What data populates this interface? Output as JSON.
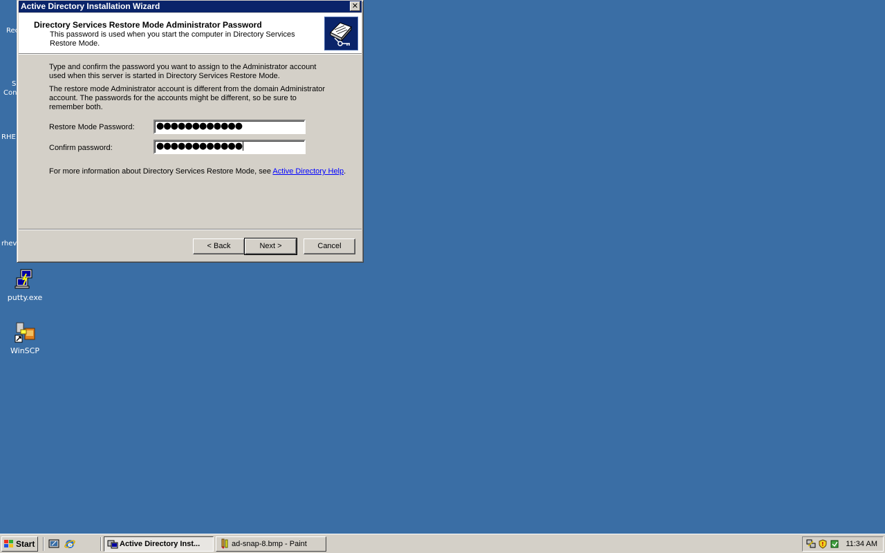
{
  "desktop": {
    "partial_labels": [
      "Rec",
      "S",
      "Con",
      "RHE",
      "rhev"
    ],
    "icons": [
      {
        "label": "putty.exe",
        "icon": "putty-icon"
      },
      {
        "label": "WinSCP",
        "icon": "winscp-icon"
      }
    ]
  },
  "wizard": {
    "title": "Active Directory Installation Wizard",
    "close_glyph": "✕",
    "header_title": "Directory Services Restore Mode Administrator Password",
    "header_subtitle": "This password is used when you start the computer in Directory Services Restore Mode.",
    "header_icon": "directory-book-icon",
    "para1": "Type and confirm the password you want to assign to the Administrator account used when this server is started in Directory Services Restore Mode.",
    "para2": "The restore mode Administrator account is different from the domain Administrator account. The passwords for the accounts might be different, so be sure to remember both.",
    "restore_password_label": "Restore Mode Password:",
    "restore_password_value": "●●●●●●●●●●●●",
    "confirm_password_label": "Confirm password:",
    "confirm_password_value": "●●●●●●●●●●●●",
    "more_info_text": "For more information about Directory Services Restore Mode, see ",
    "more_info_link": "Active Directory Help",
    "more_info_end": ".",
    "back_label": "< Back",
    "next_label": "Next >",
    "cancel_label": "Cancel"
  },
  "taskbar": {
    "start_label": "Start",
    "quick_launch": [
      "show-desktop-icon",
      "internet-explorer-icon"
    ],
    "tasks": [
      {
        "label": "Active Directory Inst...",
        "icon": "wizard-icon",
        "active": true
      },
      {
        "label": "ad-snap-8.bmp - Paint",
        "icon": "paint-icon",
        "active": false
      }
    ],
    "tray_icons": [
      "network-icon",
      "shield-icon",
      "update-icon"
    ],
    "clock": "11:34 AM"
  },
  "colors": {
    "desktop": "#3a6ea5",
    "titlebar": "#0a246a",
    "face": "#d4d0c8",
    "link": "#0000ff"
  }
}
